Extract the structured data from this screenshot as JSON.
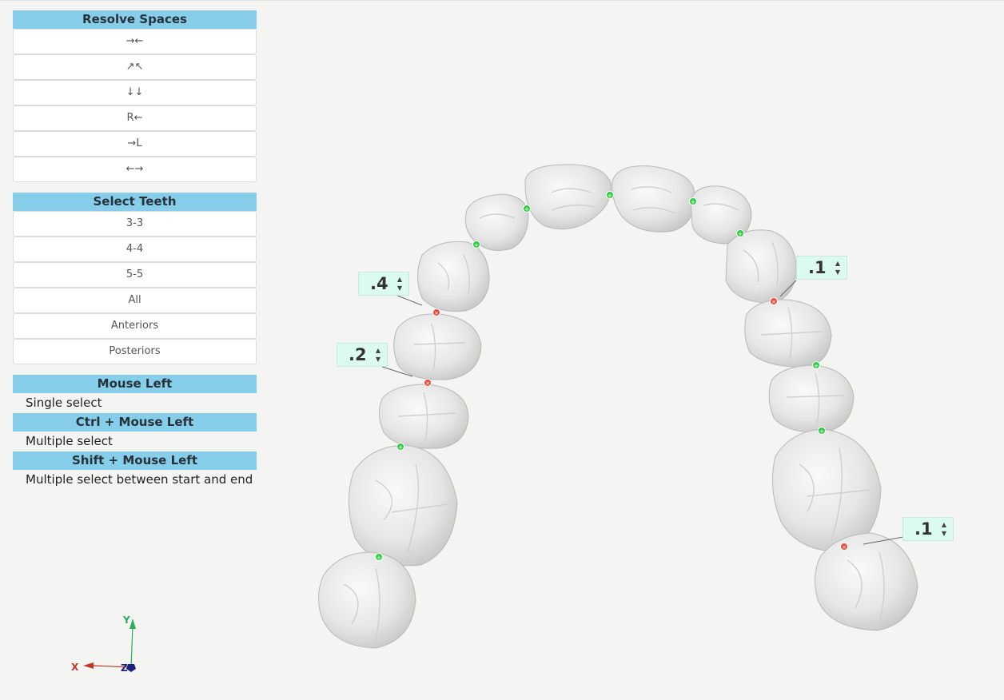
{
  "resolve_spaces": {
    "title": "Resolve Spaces",
    "buttons": [
      "→←",
      "↗↖",
      "↓↓",
      "R←",
      "→L",
      "←→"
    ]
  },
  "select_teeth": {
    "title": "Select Teeth",
    "buttons": [
      "3-3",
      "4-4",
      "5-5",
      "All",
      "Anteriors",
      "Posteriors"
    ]
  },
  "mouse_help": [
    {
      "action": "Mouse Left",
      "description": "Single select"
    },
    {
      "action": "Ctrl + Mouse Left",
      "description": "Multiple select"
    },
    {
      "action": "Shift + Mouse Left",
      "description": "Multiple select between start and end"
    }
  ],
  "space_values": [
    ".4",
    ".2",
    ".1",
    ".1"
  ],
  "axes": {
    "x": "X",
    "y": "Y",
    "z": "Z"
  },
  "colors": {
    "header_bg": "#87ceea",
    "contact_ok": "#2ecc40",
    "contact_gap": "#e74c3c",
    "value_box": "#dcfbef",
    "axis_x": "#c0392b",
    "axis_y": "#27ae60",
    "axis_z": "#1a237e"
  },
  "icons": {
    "spinner_up": "triangle-up",
    "spinner_down": "triangle-down"
  }
}
